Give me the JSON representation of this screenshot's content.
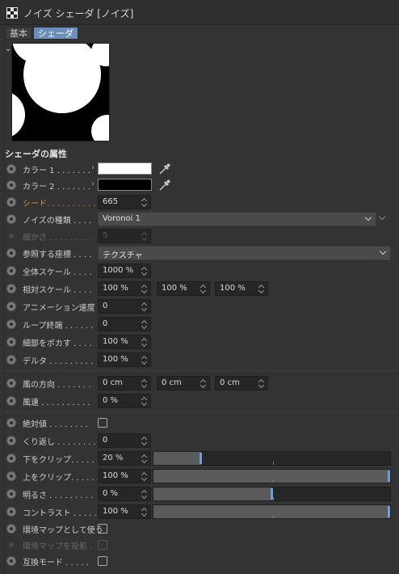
{
  "window": {
    "title": "ノイズ シェーダ [ノイズ]",
    "tabs": [
      {
        "label": "基本",
        "active": false
      },
      {
        "label": "シェーダ",
        "active": true
      }
    ]
  },
  "section": {
    "title": "シェーダの属性"
  },
  "rows": {
    "color1": {
      "label": "カラー 1 . . . . . . .",
      "color": "#ffffff"
    },
    "color2": {
      "label": "カラー 2 . . . . . . .",
      "color": "#000000"
    },
    "seed": {
      "label": "シード. . . . . . . . . .",
      "value": "665"
    },
    "noise_type": {
      "label": "ノイズの種類 . . . .",
      "value": "Voronoi 1"
    },
    "fineness": {
      "label": "細かさ . . . . . . . . .",
      "value": "5"
    },
    "ref_coord": {
      "label": "参照する座標 . . . .",
      "value": "テクスチャ"
    },
    "global_scale": {
      "label": "全体スケール . . . .",
      "value": "1000 %"
    },
    "relative_scale": {
      "label": "相対スケール . . . .",
      "values": [
        "100 %",
        "100 %",
        "100 %"
      ]
    },
    "anim_speed": {
      "label": "アニメーション速度 .",
      "value": "0"
    },
    "loop_end": {
      "label": "ループ終端 . . . . . .",
      "value": "0"
    },
    "blur_detail": {
      "label": "細部をボカす . . . .",
      "value": "100 %"
    },
    "delta": {
      "label": "デルタ . . . . . . . . .",
      "value": "100 %"
    },
    "wind_direction": {
      "label": "風の方向 . . . . . . .",
      "values": [
        "0 cm",
        "0 cm",
        "0 cm"
      ]
    },
    "wind_speed": {
      "label": "風速 . . . . . . . . . .",
      "value": "0 %"
    },
    "absolute": {
      "label": "絶対値 . . . . . . . .",
      "checked": false
    },
    "repeat": {
      "label": "くり返し . . . . . . . .",
      "value": "0"
    },
    "clip_low": {
      "label": "下をクリップ. . . . . .",
      "value": "20 %",
      "slider": 0.2
    },
    "clip_high": {
      "label": "上をクリップ. . . . . .",
      "value": "100 %",
      "slider": 1.0
    },
    "brightness": {
      "label": "明るさ . . . . . . . . .",
      "value": "0 %",
      "slider": 0.5
    },
    "contrast": {
      "label": "コントラスト . . . . .",
      "value": "100 %",
      "slider": 1.0
    },
    "use_env": {
      "label": "環境マップとして使う",
      "checked": false
    },
    "env_project": {
      "label": "環境マップを投影 .",
      "checked": false
    },
    "compat": {
      "label": "互換モード . . . . .",
      "checked": false
    }
  },
  "colors": {
    "accent": "#6b8fbd",
    "slider_handle": "#6f9fd8",
    "seed_label": "#e08a3c"
  }
}
